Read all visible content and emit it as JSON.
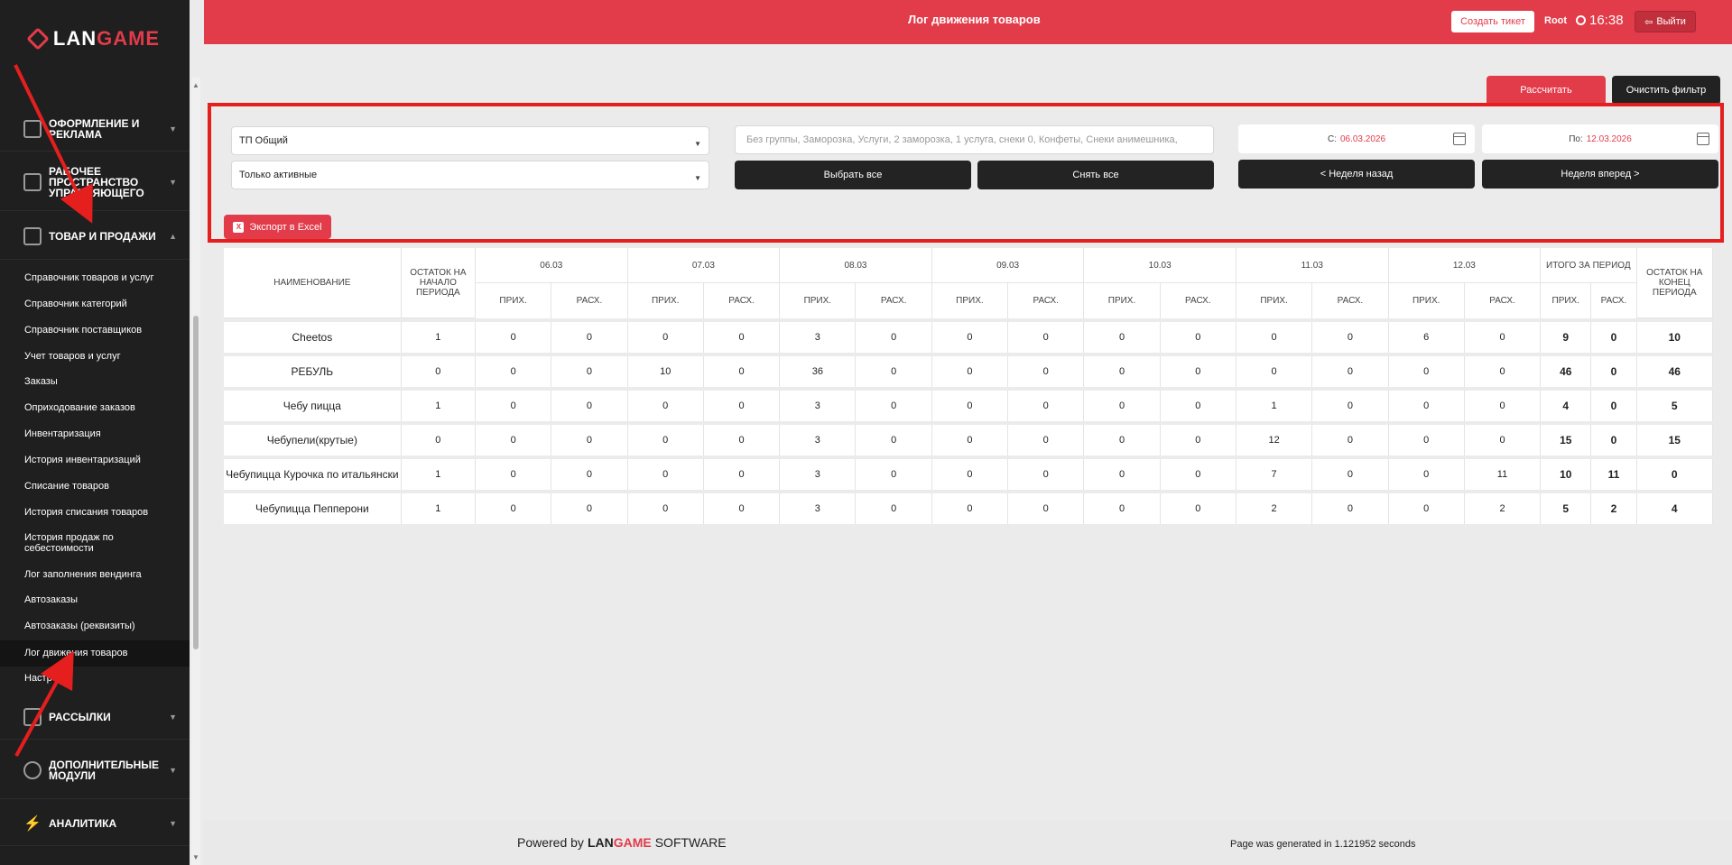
{
  "app": {
    "logo_left": "LAN",
    "logo_right": "GAME"
  },
  "sidebar": {
    "groups": [
      {
        "label": "Оформление и реклама"
      },
      {
        "label": "Рабочее пространство управляющего"
      },
      {
        "label": "Товар и продажи"
      },
      {
        "label": "Рассылки"
      },
      {
        "label": "Дополнительные модули"
      },
      {
        "label": "Аналитика"
      }
    ],
    "items": [
      {
        "label": "Справочник товаров и услуг"
      },
      {
        "label": "Справочник категорий"
      },
      {
        "label": "Справочник поставщиков"
      },
      {
        "label": "Учет товаров и услуг"
      },
      {
        "label": "Заказы"
      },
      {
        "label": "Оприходование заказов"
      },
      {
        "label": "Инвентаризация"
      },
      {
        "label": "История инвентаризаций"
      },
      {
        "label": "Списание товаров"
      },
      {
        "label": "История списания товаров"
      },
      {
        "label": "История продаж по себестоимости"
      },
      {
        "label": "Лог заполнения вендинга"
      },
      {
        "label": "Автозаказы"
      },
      {
        "label": "Автозаказы (реквизиты)"
      },
      {
        "label": "Лог движения товаров"
      },
      {
        "label": "Настройки"
      }
    ]
  },
  "header": {
    "title": "Лог движения товаров",
    "create_ticket": "Создать тикет",
    "user": "Root",
    "time": "16:38",
    "logout": "Выйти"
  },
  "actions": {
    "calculate": "Рассчитать",
    "clear_filter": "Очистить фильтр"
  },
  "filters": {
    "point": "ТП Общий",
    "status": "Только активные",
    "groups": "Без группы, Заморозка, Услуги, 2 заморозка, 1 услуга, снеки 0, Конфеты, Снеки анимешника,",
    "select_all": "Выбрать все",
    "deselect_all": "Снять все",
    "from_label": "С:",
    "from_date": "06.03.2026",
    "to_label": "По:",
    "to_date": "12.03.2026",
    "week_back": "< Неделя назад",
    "week_forward": "Неделя вперед >",
    "export": "Экспорт в Excel"
  },
  "table": {
    "name_header": "Наименование",
    "start_header": "Остаток на начало периода",
    "total_header": "Итого за период",
    "end_header": "Остаток на конец периода",
    "in_label": "Прих.",
    "out_label": "Расх.",
    "dates": [
      "06.03",
      "07.03",
      "08.03",
      "09.03",
      "10.03",
      "11.03",
      "12.03"
    ],
    "rows": [
      {
        "name": "Cheetos",
        "start": "1",
        "days": [
          [
            "0",
            "0"
          ],
          [
            "0",
            "0"
          ],
          [
            "3",
            "0"
          ],
          [
            "0",
            "0"
          ],
          [
            "0",
            "0"
          ],
          [
            "0",
            "0"
          ],
          [
            "6",
            "0"
          ]
        ],
        "total_in": "9",
        "total_out": "0",
        "end": "10"
      },
      {
        "name": "РЕБУЛЬ",
        "start": "0",
        "days": [
          [
            "0",
            "0"
          ],
          [
            "10",
            "0"
          ],
          [
            "36",
            "0"
          ],
          [
            "0",
            "0"
          ],
          [
            "0",
            "0"
          ],
          [
            "0",
            "0"
          ],
          [
            "0",
            "0"
          ]
        ],
        "total_in": "46",
        "total_out": "0",
        "end": "46"
      },
      {
        "name": "Чебу пицца",
        "start": "1",
        "days": [
          [
            "0",
            "0"
          ],
          [
            "0",
            "0"
          ],
          [
            "3",
            "0"
          ],
          [
            "0",
            "0"
          ],
          [
            "0",
            "0"
          ],
          [
            "1",
            "0"
          ],
          [
            "0",
            "0"
          ]
        ],
        "total_in": "4",
        "total_out": "0",
        "end": "5"
      },
      {
        "name": "Чебупели(крутые)",
        "start": "0",
        "days": [
          [
            "0",
            "0"
          ],
          [
            "0",
            "0"
          ],
          [
            "3",
            "0"
          ],
          [
            "0",
            "0"
          ],
          [
            "0",
            "0"
          ],
          [
            "12",
            "0"
          ],
          [
            "0",
            "0"
          ]
        ],
        "total_in": "15",
        "total_out": "0",
        "end": "15"
      },
      {
        "name": "Чебупицца Курочка по итальянски",
        "start": "1",
        "days": [
          [
            "0",
            "0"
          ],
          [
            "0",
            "0"
          ],
          [
            "3",
            "0"
          ],
          [
            "0",
            "0"
          ],
          [
            "0",
            "0"
          ],
          [
            "7",
            "0"
          ],
          [
            "0",
            "11"
          ]
        ],
        "total_in": "10",
        "total_out": "11",
        "end": "0"
      },
      {
        "name": "Чебупицца Пепперони",
        "start": "1",
        "days": [
          [
            "0",
            "0"
          ],
          [
            "0",
            "0"
          ],
          [
            "3",
            "0"
          ],
          [
            "0",
            "0"
          ],
          [
            "0",
            "0"
          ],
          [
            "2",
            "0"
          ],
          [
            "0",
            "2"
          ]
        ],
        "total_in": "5",
        "total_out": "2",
        "end": "4"
      }
    ]
  },
  "footer": {
    "powered_by": "Powered by",
    "brand_left": "LAN",
    "brand_right": "GAME",
    "software": "SOFTWARE",
    "generated": "Page was generated in 1.121952 seconds"
  }
}
